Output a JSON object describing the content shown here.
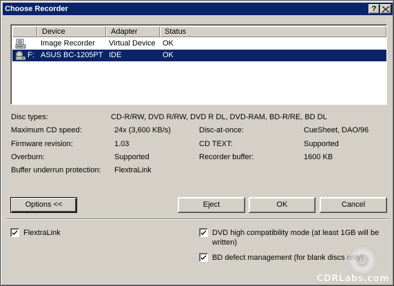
{
  "window": {
    "title": "Choose Recorder",
    "help_label": "?",
    "close_label": "✕"
  },
  "recorder_list": {
    "columns": [
      "Device",
      "Adapter",
      "Status"
    ],
    "rows": [
      {
        "icon": "image-recorder-icon",
        "drive": "",
        "device": "Image Recorder",
        "adapter": "Virtual Device",
        "status": "OK",
        "selected": false
      },
      {
        "icon": "optical-drive-icon",
        "drive": "F:",
        "device": "ASUS BC-1205PT",
        "adapter": "IDE",
        "status": "OK",
        "selected": true
      }
    ]
  },
  "info": {
    "disc_types_label": "Disc types:",
    "disc_types_value": "CD-R/RW, DVD R/RW, DVD R DL, DVD-RAM, BD-R/RE, BD DL",
    "max_cd_speed_label": "Maximum CD speed:",
    "max_cd_speed_value": "24x (3,600 KB/s)",
    "firmware_label": "Firmware revision:",
    "firmware_value": "1.03",
    "overburn_label": "Overburn:",
    "overburn_value": "Supported",
    "buffer_underrun_label": "Buffer underrun protection:",
    "buffer_underrun_value": "FlextraLink",
    "dao_label": "Disc-at-once:",
    "dao_value": "CueSheet, DAO/96",
    "cd_text_label": "CD TEXT:",
    "cd_text_value": "Supported",
    "recorder_buffer_label": "Recorder buffer:",
    "recorder_buffer_value": "1600 KB"
  },
  "buttons": {
    "options": "Options <<",
    "eject": "Eject",
    "ok": "OK",
    "cancel": "Cancel"
  },
  "options": {
    "flextralink_label": "FlextraLink",
    "flextralink_checked": true,
    "dvd_compat_label_line1": "DVD high compatibility mode (at least 1GB will be",
    "dvd_compat_label_line2": "written)",
    "dvd_compat_checked": true,
    "bd_defect_label": "BD defect management (for blank discs only)",
    "bd_defect_checked": true
  },
  "watermark": "CDRLabs.com",
  "colors": {
    "titlebar": "#0a246a",
    "selection": "#0a246a",
    "face": "#d4d0c8"
  }
}
